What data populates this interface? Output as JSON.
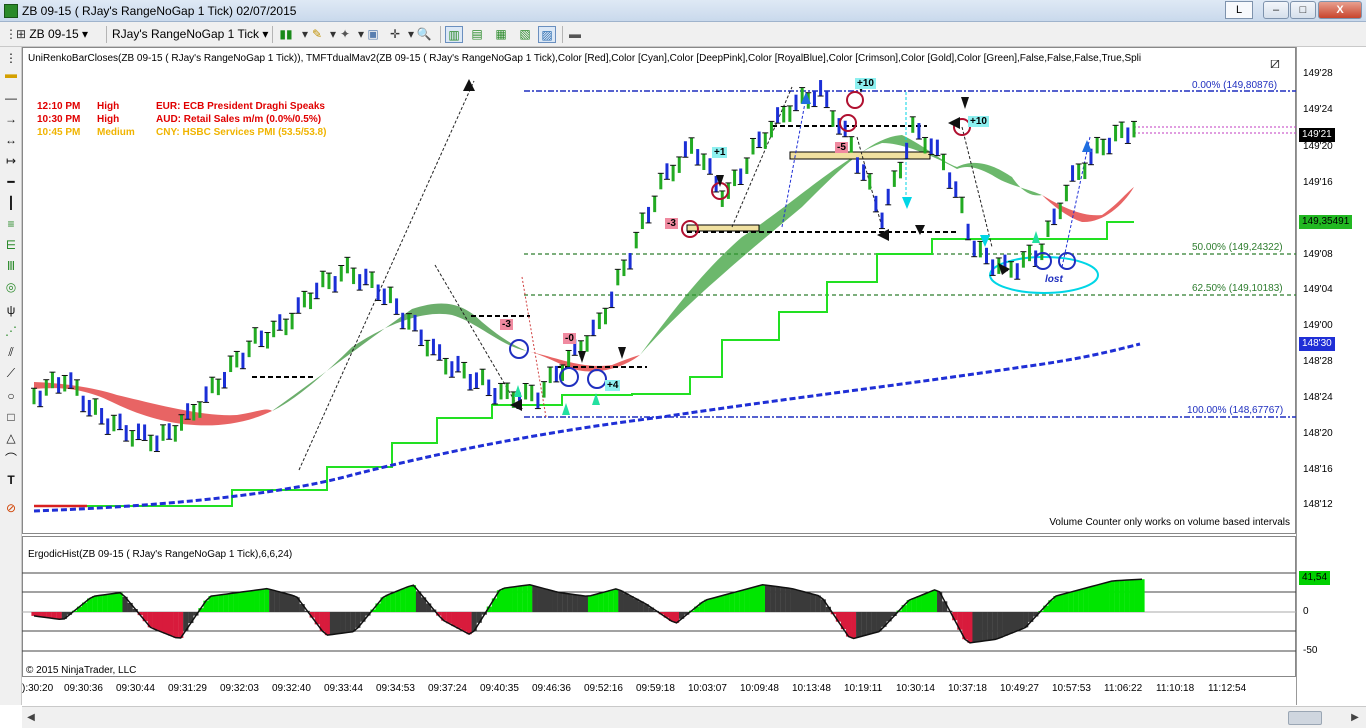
{
  "window": {
    "title": "ZB 09-15 ( RJay's RangeNoGap  1 Tick)  02/07/2015",
    "link_button": "L",
    "minimize": "–",
    "maximize": "□",
    "close": "X"
  },
  "toolbar": {
    "instrument": "ZB 09-15",
    "interval": "RJay's RangeNoGap  1 Tick",
    "dropdown_arrow": "▾"
  },
  "chart_legend": "UniRenkoBarCloses(ZB 09-15 ( RJay's RangeNoGap  1 Tick)), TMFTdualMav2(ZB 09-15 ( RJay's RangeNoGap  1 Tick),Color [Red],Color [Cyan],Color [DeepPink],Color [RoyalBlue],Color [Crimson],Color [Gold],Color [Green],False,False,False,True,Spli",
  "news_events": [
    {
      "time": "12:10 PM",
      "importance": "High",
      "text": "EUR: ECB President Draghi Speaks",
      "color": "#e00000"
    },
    {
      "time": "10:30 PM",
      "importance": "High",
      "text": "AUD: Retail Sales m/m (0.0%/0.5%)",
      "color": "#e00000"
    },
    {
      "time": "10:45 PM",
      "importance": "Medium",
      "text": "CNY: HSBC Services PMI (53.5/53.8)",
      "color": "#f0b400"
    }
  ],
  "fib_labels": [
    {
      "text": "0.00% (149,80876)",
      "color": "#1f2fbf"
    },
    {
      "text": "50.00% (149,24322)",
      "color": "#2e7d2e"
    },
    {
      "text": "62.50% (149,10183)",
      "color": "#2e7d2e"
    },
    {
      "text": "100.00% (148,67767)",
      "color": "#1f2fbf"
    }
  ],
  "price_axis": [
    "149'28",
    "149'24",
    "149'20",
    "149'16",
    "149'08",
    "149'04",
    "149'00",
    "148'28",
    "148'24",
    "148'20",
    "148'16",
    "148'12"
  ],
  "price_badges": {
    "last": "149'21",
    "green": "149,35491",
    "blue": "148'30",
    "osc": "41,54"
  },
  "osc_axis": [
    "0",
    "-50"
  ],
  "annotations": {
    "trade_labels": [
      "-3",
      "-0",
      "+4",
      "-3",
      "+1",
      "-5",
      "+10",
      "+10"
    ],
    "lost_label": "lost"
  },
  "volume_counter_note": "Volume Counter only works on volume based intervals",
  "oscillator_legend": "ErgodicHist(ZB 09-15 ( RJay's RangeNoGap  1 Tick),6,6,24)",
  "copyright": "© 2015 NinjaTrader, LLC",
  "time_axis": [
    "):30:20",
    "09:30:36",
    "09:30:44",
    "09:31:29",
    "09:32:03",
    "09:32:40",
    "09:33:44",
    "09:34:53",
    "09:37:24",
    "09:40:35",
    "09:46:36",
    "09:52:16",
    "09:59:18",
    "10:03:07",
    "10:09:48",
    "10:13:48",
    "10:19:11",
    "10:30:14",
    "10:37:18",
    "10:49:27",
    "10:57:53",
    "11:06:22",
    "11:10:18",
    "11:12:54"
  ],
  "colors": {
    "bull_bar": "#22aa22",
    "bear_bar": "#1b2fd6",
    "osc_green": "#00e600",
    "osc_red": "#d81b3c",
    "osc_dark": "#3a3a3a",
    "ribbon_green": "#3f9f3f",
    "ribbon_red": "#e03030"
  },
  "chart_data": {
    "type": "candlestick",
    "instrument": "ZB 09-15",
    "price_bars_close": [
      148.24,
      148.26,
      148.22,
      148.2,
      148.19,
      148.22,
      148.26,
      148.3,
      149.0,
      149.04,
      149.06,
      149.04,
      149.0,
      148.28,
      148.26,
      148.24,
      148.24,
      148.28,
      149.0,
      149.08,
      149.16,
      149.2,
      149.14,
      149.2,
      149.24,
      149.26,
      149.2,
      149.12,
      149.22,
      149.18,
      149.08,
      149.06,
      149.08,
      149.16,
      149.2,
      149.22
    ],
    "ergodic_hist": [
      -5,
      -10,
      20,
      25,
      -20,
      -35,
      20,
      25,
      30,
      20,
      -30,
      -25,
      20,
      35,
      -10,
      -30,
      30,
      35,
      25,
      20,
      30,
      10,
      -15,
      15,
      25,
      35,
      30,
      20,
      -35,
      -25,
      15,
      30,
      -40,
      -35,
      -20,
      20,
      30,
      40,
      42
    ],
    "osc_range": [
      -60,
      50
    ]
  }
}
